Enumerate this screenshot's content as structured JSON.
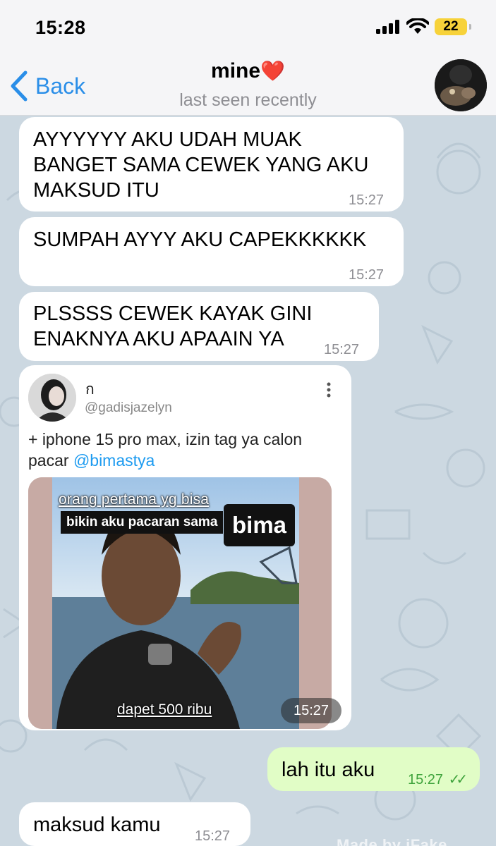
{
  "status_bar": {
    "time": "15:28",
    "battery": "22",
    "icons": [
      "cellular-signal-icon",
      "wifi-icon",
      "battery-icon"
    ],
    "battery_color": "#f7d23a"
  },
  "header": {
    "back_label": "Back",
    "chat_name": "mine",
    "chat_name_emoji": "❤️",
    "status": "last seen recently",
    "accent_color": "#2a8ee8"
  },
  "messages": [
    {
      "text": "AYYYYYY AKU UDAH MUAK BANGET SAMA CEWEK YANG AKU MAKSUD ITU",
      "time": "15:27",
      "direction": "in"
    },
    {
      "text": "SUMPAH AYYY AKU CAPEKKKKKK",
      "time": "15:27",
      "direction": "in"
    },
    {
      "text": "PLSSSS CEWEK KAYAK GINI ENAKNYA AKU APAAIN YA",
      "time": "15:27",
      "direction": "in"
    },
    {
      "text": "lah itu aku",
      "time": "15:27",
      "direction": "out",
      "read_receipt": "✓✓"
    },
    {
      "text": "maksud kamu",
      "time": "15:27",
      "direction": "in"
    }
  ],
  "forwarded_post": {
    "display_name": "ก",
    "handle": "@gadisjazelyn",
    "text": "+ iphone 15 pro max, izin tag ya calon pacar ",
    "mention": "@bimastya",
    "meme_caption_top": "orang pertama yg bisa",
    "meme_caption_mid": "bikin aku pacaran sama",
    "meme_caption_name": "bima",
    "meme_caption_bottom": "dapet 500 ribu",
    "time": "15:27"
  },
  "watermark": "Made by iFake",
  "colors": {
    "chat_background": "#ccd8e1",
    "incoming_bubble": "#ffffff",
    "outgoing_bubble": "#e1fdc6",
    "outgoing_time": "#3fa33c",
    "link": "#1d9bf0"
  }
}
